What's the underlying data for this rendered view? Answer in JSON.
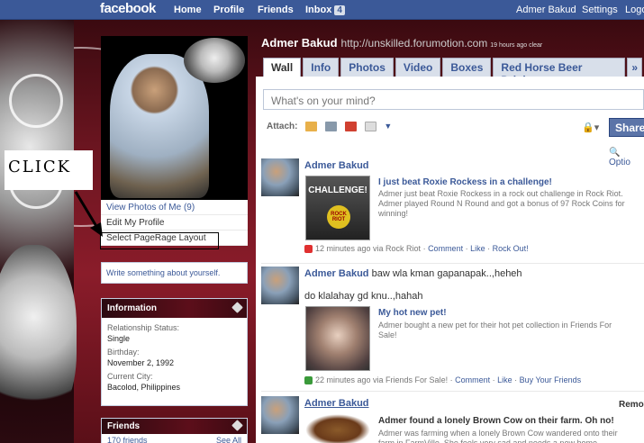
{
  "topbar": {
    "logo": "facebook",
    "nav": [
      "Home",
      "Profile",
      "Friends",
      "Inbox"
    ],
    "inbox_count": "4",
    "user_name": "Admer Bakud",
    "settings": "Settings",
    "logout": "Logo"
  },
  "profile": {
    "name": "Admer Bakud",
    "status": "http://unskilled.forumotion.com",
    "status_time": "19 hours ago clear",
    "tabs": [
      "Wall",
      "Info",
      "Photos",
      "Video",
      "Boxes",
      "Red Horse Beer Drinkers"
    ],
    "tab_more": "»",
    "left_links": {
      "view_photos": "View Photos of Me (9)",
      "edit_profile": "Edit My Profile",
      "select_layout": "Select PageRage Layout"
    },
    "write_about": "Write something about yourself.",
    "information": {
      "title": "Information",
      "relationship_label": "Relationship Status:",
      "relationship_value": "Single",
      "birthday_label": "Birthday:",
      "birthday_value": "November 2, 1992",
      "city_label": "Current City:",
      "city_value": "Bacolod, Philippines"
    },
    "friends": {
      "title": "Friends",
      "count": "170 friends",
      "see_all": "See All"
    }
  },
  "annotation": {
    "click_label": "CLICK"
  },
  "composer": {
    "placeholder": "What's on your mind?",
    "attach_label": "Attach:",
    "share": "Share",
    "options": "Optio"
  },
  "stories": [
    {
      "author": "Admer Bakud",
      "attachment_title": "I just beat Roxie Rockess in a challenge!",
      "attachment_desc": "Admer just beat Roxie Rockess in a rock out challenge in Rock Riot. Admer played Round N Round and got a bonus of 97 Rock Coins for winning!",
      "thumb_text": "CHALLENGE!",
      "thumb_badge": "ROCK RIOT",
      "meta_time": "12 minutes ago via Rock Riot",
      "actions": [
        "Comment",
        "Like",
        "Rock Out!"
      ]
    },
    {
      "author": "Admer Bakud",
      "text": "baw wla kman gapanapak..,heheh",
      "line2": "do klalahay gd knu..,hahah",
      "attachment_title": "My hot new pet!",
      "attachment_desc": "Admer bought a new pet for their hot pet collection in Friends For Sale!",
      "meta_time": "22 minutes ago via Friends For Sale!",
      "actions": [
        "Comment",
        "Like",
        "Buy Your Friends"
      ]
    },
    {
      "author": "Admer Bakud",
      "remove": "Remov",
      "attachment_title": "Admer found a lonely Brown Cow on their farm. Oh no!",
      "attachment_desc": "Admer was farming when a lonely Brown Cow wandered onto their farm in FarmVille. She feels very sad and needs a new home."
    }
  ]
}
